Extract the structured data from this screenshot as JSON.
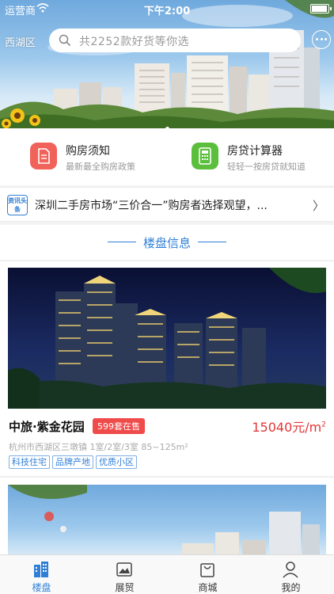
{
  "status": {
    "carrier": "运营商",
    "time": "下午2:00",
    "battery_level": 0.85
  },
  "header": {
    "location": "西湖区",
    "search_placeholder": "共2252款好货等你选"
  },
  "banner": {
    "slide_count": 1,
    "active_slide": 1
  },
  "quick_entries": [
    {
      "title": "购房须知",
      "subtitle": "最新最全购房政策",
      "icon": "document-icon",
      "color": "#f0625a"
    },
    {
      "title": "房贷计算器",
      "subtitle": "轻轻一按房贷就知道",
      "icon": "calculator-icon",
      "color": "#5bbf3d"
    }
  ],
  "news": {
    "badge": "资讯头条",
    "text": "深圳二手房市场“三价合一”购房者选择观望，..."
  },
  "section": {
    "title": "楼盘信息"
  },
  "listings": [
    {
      "name": "中旅·紫金花园",
      "stock": "599套在售",
      "price": "15040元/m",
      "price_sup": "2",
      "address": "杭州市西湖区三墩镇 1室/2室/3室 85~125m²",
      "tags": [
        "科技住宅",
        "品牌产地",
        "优质小区"
      ]
    }
  ],
  "tabs": [
    {
      "label": "楼盘",
      "icon": "building-icon",
      "active": true
    },
    {
      "label": "展贸",
      "icon": "picture-icon",
      "active": false
    },
    {
      "label": "商城",
      "icon": "bag-icon",
      "active": false
    },
    {
      "label": "我的",
      "icon": "person-icon",
      "active": false
    }
  ],
  "colors": {
    "accent": "#2f7fd6",
    "price": "#e43636",
    "stock_badge": "#ef4b4b"
  }
}
